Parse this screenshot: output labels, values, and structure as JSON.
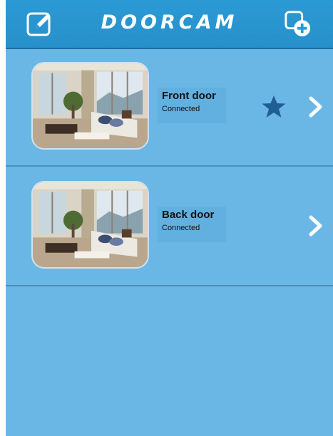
{
  "header": {
    "title": "DOORCAM",
    "edit_icon": "pencil-edit-icon",
    "add_icon": "add-camera-icon"
  },
  "colors": {
    "background": "#6ab7e6",
    "header": "#2b9ad4",
    "divider": "#4f8fb8",
    "star": "#1f5f93",
    "chevron": "#ffffff"
  },
  "cameras": [
    {
      "name": "Front door",
      "status": "Connected",
      "favorite": true,
      "thumbnail_icon": "camera-preview"
    },
    {
      "name": "Back door",
      "status": "Connected",
      "favorite": false,
      "thumbnail_icon": "camera-preview"
    }
  ]
}
